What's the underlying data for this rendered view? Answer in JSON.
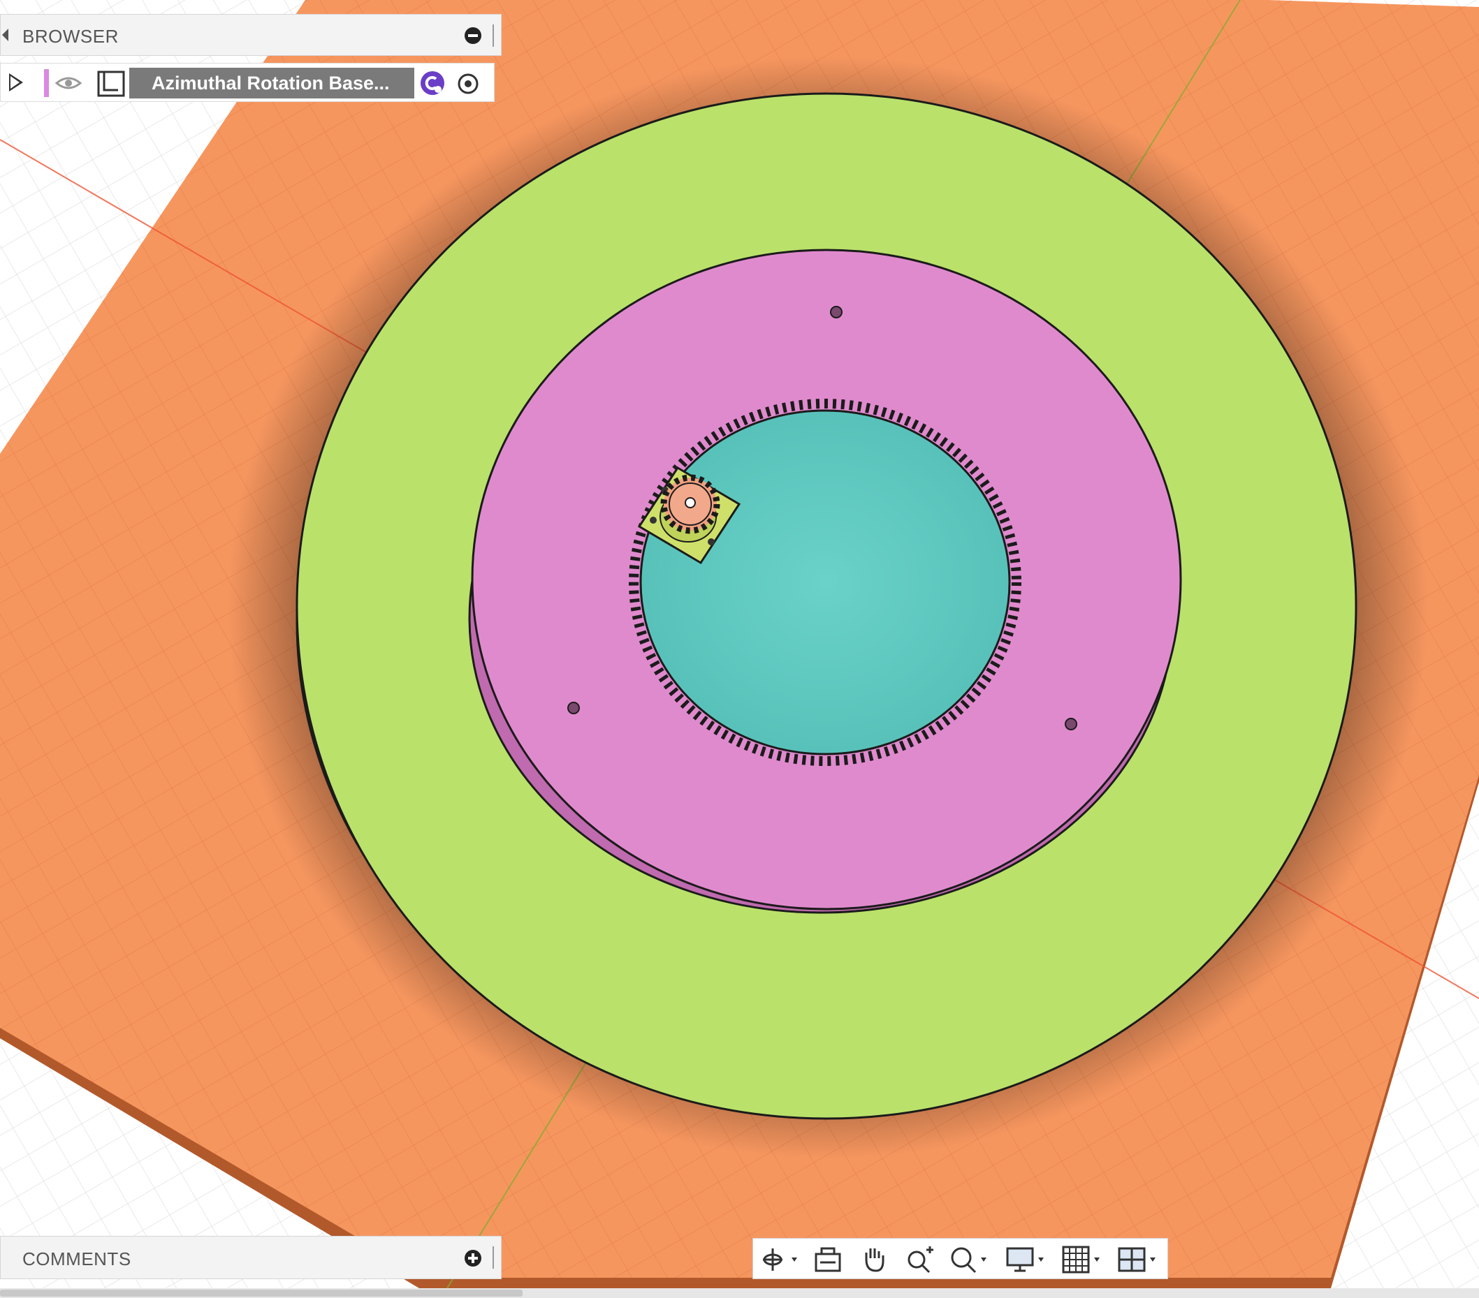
{
  "browser": {
    "title": "BROWSER",
    "component": {
      "name": "Azimuthal Rotation Base..."
    }
  },
  "comments": {
    "title": "COMMENTS"
  },
  "colors": {
    "ground_plate": "#f6965f",
    "outer_ring": "#bae16a",
    "inner_plate": "#e08ace",
    "ring_gear_center": "#62cec4",
    "pinion": "#f0a080",
    "motor_mount": "#cfe06a",
    "accent_purple": "#6a3ec7"
  },
  "nav_toolbar": {
    "tools": [
      "orbit-icon",
      "look-at-icon",
      "pan-icon",
      "zoom-icon",
      "fit-icon",
      "display-settings-icon",
      "grid-settings-icon",
      "viewports-icon"
    ]
  }
}
